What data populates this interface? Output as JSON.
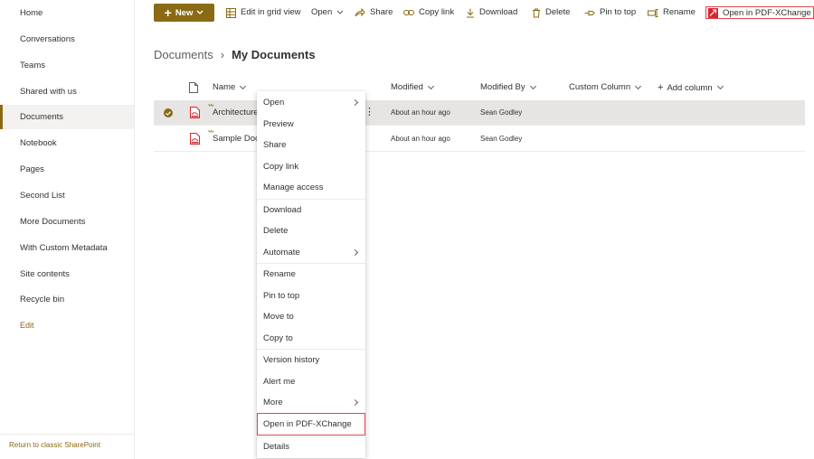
{
  "nav": {
    "items": [
      {
        "label": "Home"
      },
      {
        "label": "Conversations"
      },
      {
        "label": "Teams"
      },
      {
        "label": "Shared with us"
      },
      {
        "label": "Documents"
      },
      {
        "label": "Notebook"
      },
      {
        "label": "Pages"
      },
      {
        "label": "Second List"
      },
      {
        "label": "More Documents"
      },
      {
        "label": "With Custom Metadata"
      },
      {
        "label": "Site contents"
      },
      {
        "label": "Recycle bin"
      }
    ],
    "edit_label": "Edit",
    "return_label": "Return to classic SharePoint",
    "active": "Documents"
  },
  "toolbar": {
    "new_label": "New",
    "edit_grid_label": "Edit in grid view",
    "open_label": "Open",
    "share_label": "Share",
    "copy_link_label": "Copy link",
    "download_label": "Download",
    "delete_label": "Delete",
    "pin_label": "Pin to top",
    "rename_label": "Rename",
    "pdfx_label": "Open in PDF-XChange"
  },
  "breadcrumb": {
    "parent": "Documents",
    "current": "My Documents"
  },
  "columns": {
    "name": "Name",
    "modified": "Modified",
    "modified_by": "Modified By",
    "custom": "Custom Column",
    "add": "Add column"
  },
  "rows": [
    {
      "name": "Architecture",
      "modified": "About an hour ago",
      "modified_by": "Sean Godley"
    },
    {
      "name": "Sample Doc",
      "modified": "About an hour ago",
      "modified_by": "Sean Godley"
    }
  ],
  "context_menu": {
    "items": [
      {
        "label": "Open"
      },
      {
        "label": "Preview"
      },
      {
        "label": "Share"
      },
      {
        "label": "Copy link"
      },
      {
        "label": "Manage access"
      },
      {
        "label": "Download"
      },
      {
        "label": "Delete"
      },
      {
        "label": "Automate"
      },
      {
        "label": "Rename"
      },
      {
        "label": "Pin to top"
      },
      {
        "label": "Move to"
      },
      {
        "label": "Copy to"
      },
      {
        "label": "Version history"
      },
      {
        "label": "Alert me"
      },
      {
        "label": "More"
      },
      {
        "label": "Open in PDF-XChange"
      },
      {
        "label": "Details"
      }
    ]
  },
  "colors": {
    "accent": "#8a6a14",
    "highlight_border": "#e0474c",
    "selected_row": "#e6e5e3"
  }
}
